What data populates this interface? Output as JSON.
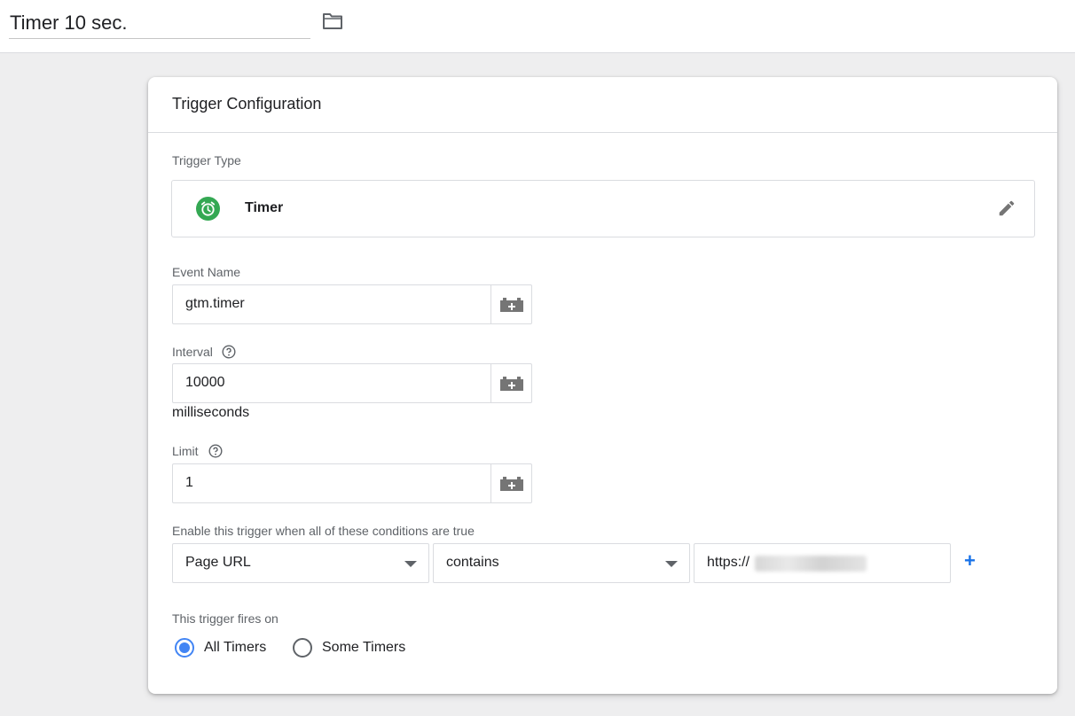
{
  "header": {
    "trigger_name": "Timer 10 sec.",
    "folder_icon": "folder-icon"
  },
  "card": {
    "title": "Trigger Configuration",
    "trigger_type": {
      "label": "Trigger Type",
      "name": "Timer",
      "icon": "timer-icon",
      "icon_color": "#34a853",
      "edit_icon": "pencil-icon"
    },
    "event_name": {
      "label": "Event Name",
      "value": "gtm.timer"
    },
    "interval": {
      "label": "Interval",
      "value": "10000",
      "unit": "milliseconds"
    },
    "limit": {
      "label": "Limit",
      "value": "1"
    },
    "conditions": {
      "label": "Enable this trigger when all of these conditions are true",
      "variable": "Page URL",
      "operator": "contains",
      "value_prefix": "https://",
      "add_label": "+"
    },
    "fires_on": {
      "label": "This trigger fires on",
      "options": [
        "All Timers",
        "Some Timers"
      ],
      "selected": "All Timers"
    }
  },
  "colors": {
    "accent": "#4285f4",
    "link": "#1a73e8",
    "timer_green": "#34a853"
  }
}
